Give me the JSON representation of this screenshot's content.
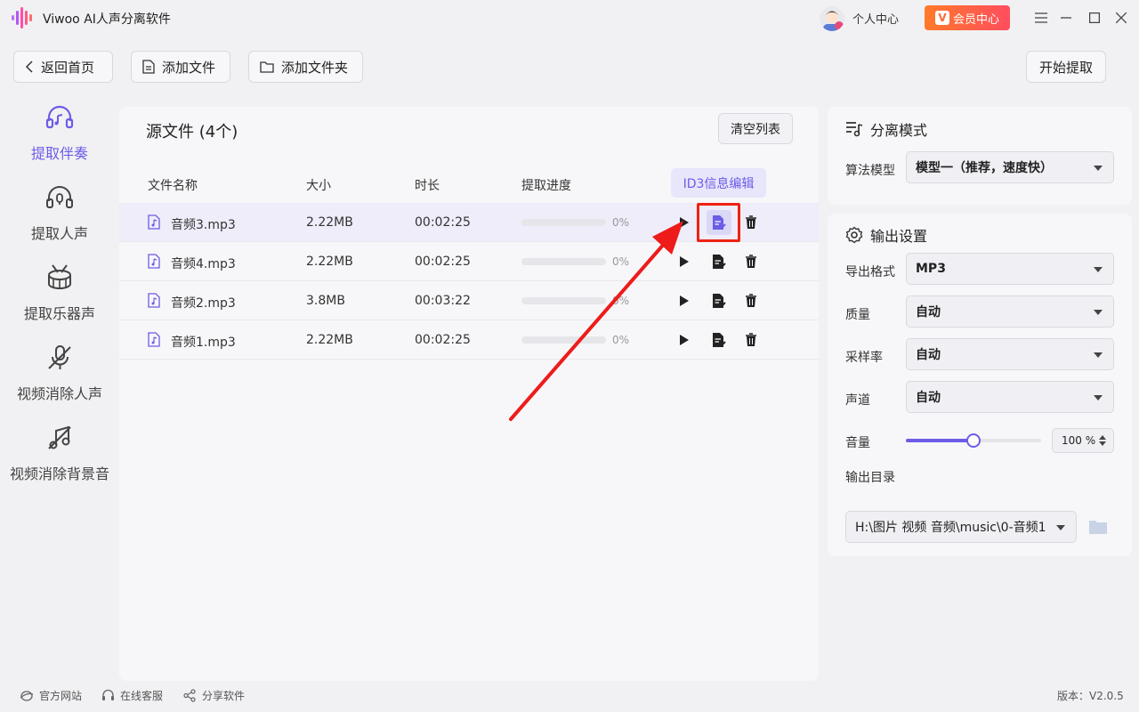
{
  "app": {
    "title": "Viwoo AI人声分离软件",
    "user_label": "个人中心",
    "vip_label": "会员中心",
    "vip_badge": "V"
  },
  "toolbar": {
    "back": "返回首页",
    "add_file": "添加文件",
    "add_folder": "添加文件夹",
    "start": "开始提取"
  },
  "sidebar": {
    "items": [
      {
        "label": "提取伴奏",
        "icon": "headphones-music-icon",
        "active": true
      },
      {
        "label": "提取人声",
        "icon": "headphones-mic-icon"
      },
      {
        "label": "提取乐器声",
        "icon": "drum-icon"
      },
      {
        "label": "视频消除人声",
        "icon": "mic-off-icon"
      },
      {
        "label": "视频消除背景音",
        "icon": "music-off-icon"
      }
    ]
  },
  "main": {
    "title": "源文件 (4个)",
    "clear_label": "清空列表",
    "columns": {
      "name": "文件名称",
      "size": "大小",
      "duration": "时长",
      "progress": "提取进度"
    },
    "id3_label": "ID3信息编辑",
    "rows": [
      {
        "name": "音频3.mp3",
        "size": "2.22MB",
        "duration": "00:02:25",
        "progress": "0%",
        "selected": true
      },
      {
        "name": "音频4.mp3",
        "size": "2.22MB",
        "duration": "00:02:25",
        "progress": "0%"
      },
      {
        "name": "音频2.mp3",
        "size": "3.8MB",
        "duration": "00:03:22",
        "progress": "0%"
      },
      {
        "name": "音频1.mp3",
        "size": "2.22MB",
        "duration": "00:02:25",
        "progress": "0%"
      }
    ]
  },
  "separation": {
    "title": "分离模式",
    "algo_label": "算法模型",
    "algo_value": "模型一（推荐，速度快）"
  },
  "output": {
    "title": "输出设置",
    "format_label": "导出格式",
    "format_value": "MP3",
    "quality_label": "质量",
    "quality_value": "自动",
    "rate_label": "采样率",
    "rate_value": "自动",
    "channel_label": "声道",
    "channel_value": "自动",
    "volume_label": "音量",
    "volume_value": "100 %",
    "volume_level": 0.5,
    "dir_label": "输出目录",
    "dir_value": "H:\\图片 视频 音频\\music\\0-音频1"
  },
  "footer": {
    "site": "官方网站",
    "support": "在线客服",
    "share": "分享软件",
    "version": "版本：V2.0.5"
  },
  "colors": {
    "accent": "#6c5ce7",
    "highlight": "#e21111",
    "vip_start": "#ff7a2a",
    "vip_end": "#ff4d5e"
  }
}
